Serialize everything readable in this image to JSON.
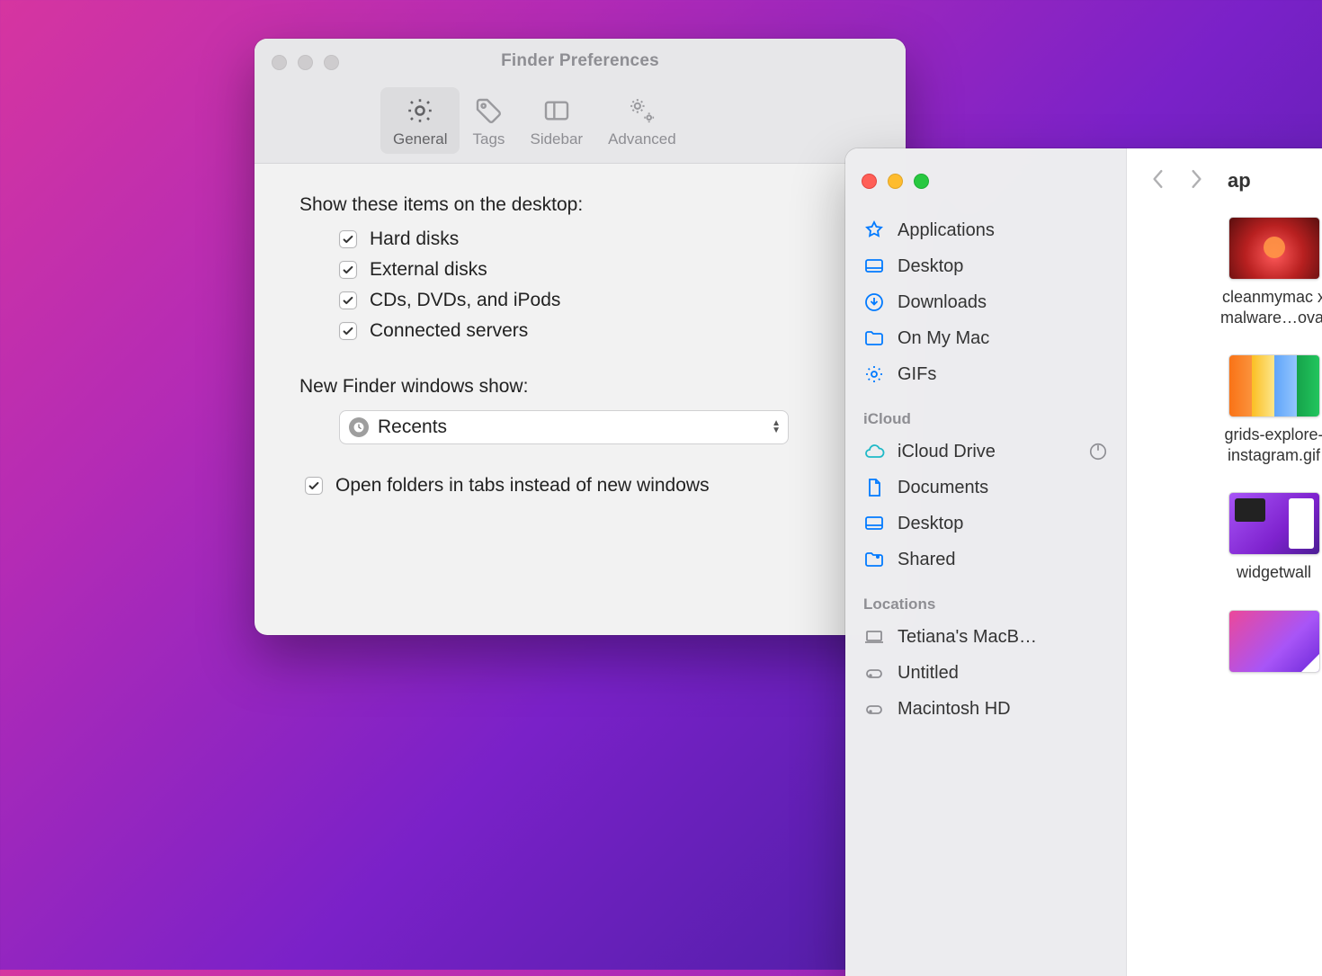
{
  "prefs": {
    "title": "Finder Preferences",
    "tabs": {
      "general": "General",
      "tags": "Tags",
      "sidebar": "Sidebar",
      "advanced": "Advanced"
    },
    "section1": "Show these items on the desktop:",
    "checks": {
      "hd": "Hard disks",
      "ext": "External disks",
      "cd": "CDs, DVDs, and iPods",
      "srv": "Connected servers"
    },
    "section2": "New Finder windows show:",
    "select_value": "Recents",
    "tabs_check": "Open folders in tabs instead of new windows"
  },
  "finder": {
    "location_prefix": "ap",
    "favorites": {
      "apps": "Applications",
      "desktop": "Desktop",
      "downloads": "Downloads",
      "onmymac": "On My Mac",
      "gifs": "GIFs"
    },
    "icloud_head": "iCloud",
    "icloud": {
      "drive": "iCloud Drive",
      "docs": "Documents",
      "desktop": "Desktop",
      "shared": "Shared"
    },
    "locations_head": "Locations",
    "locations": {
      "machine": "Tetiana's MacB…",
      "untitled": "Untitled",
      "machd": "Macintosh HD"
    },
    "files": {
      "f1a": "cleanmymac x",
      "f1b": "malware…oval",
      "f2a": "grids-explore-",
      "f2b": "instagram.gif",
      "f3": "widgetwall"
    }
  }
}
